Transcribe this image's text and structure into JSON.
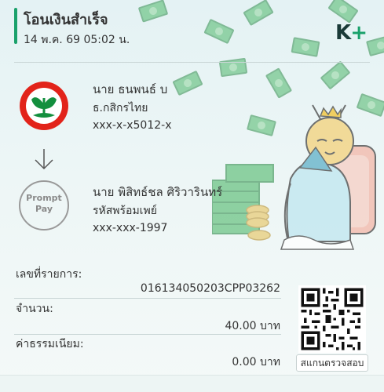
{
  "header": {
    "title": "โอนเงินสำเร็จ",
    "datetime": "14 พ.ค. 69  05:02 น.",
    "brand_k": "K",
    "brand_plus": "+"
  },
  "sender": {
    "name": "นาย ธนพนธ์ บ",
    "bank": "ธ.กสิกรไทย",
    "account": "xxx-x-x5012-x"
  },
  "receiver": {
    "logo_line1": "Prompt",
    "logo_line2": "Pay",
    "name": "นาย พิสิทธ์ชล ศิริวารินทร์",
    "bank": "รหัสพร้อมเพย์",
    "account": "xxx-xxx-1997"
  },
  "details": {
    "ref_label": "เลขที่รายการ:",
    "ref_value": "016134050203CPP03262",
    "amount_label": "จำนวน:",
    "amount_value": "40.00 บาท",
    "fee_label": "ค่าธรรมเนียม:",
    "fee_value": "0.00 บาท"
  },
  "qr": {
    "caption": "สแกนตรวจสอบ"
  },
  "colors": {
    "accent_green": "#1aa16b",
    "kbank_red": "#e2231a",
    "kbank_green": "#138f3e"
  }
}
